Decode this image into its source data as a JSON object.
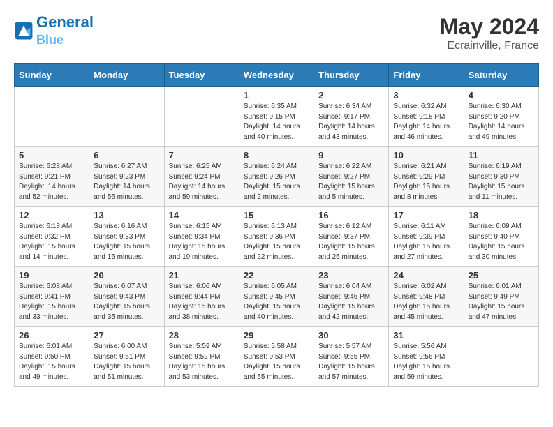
{
  "header": {
    "logo_line1": "General",
    "logo_line2": "Blue",
    "month_year": "May 2024",
    "location": "Ecrainville, France"
  },
  "weekdays": [
    "Sunday",
    "Monday",
    "Tuesday",
    "Wednesday",
    "Thursday",
    "Friday",
    "Saturday"
  ],
  "weeks": [
    [
      {
        "num": "",
        "info": ""
      },
      {
        "num": "",
        "info": ""
      },
      {
        "num": "",
        "info": ""
      },
      {
        "num": "1",
        "info": "Sunrise: 6:35 AM\nSunset: 9:15 PM\nDaylight: 14 hours\nand 40 minutes."
      },
      {
        "num": "2",
        "info": "Sunrise: 6:34 AM\nSunset: 9:17 PM\nDaylight: 14 hours\nand 43 minutes."
      },
      {
        "num": "3",
        "info": "Sunrise: 6:32 AM\nSunset: 9:18 PM\nDaylight: 14 hours\nand 46 minutes."
      },
      {
        "num": "4",
        "info": "Sunrise: 6:30 AM\nSunset: 9:20 PM\nDaylight: 14 hours\nand 49 minutes."
      }
    ],
    [
      {
        "num": "5",
        "info": "Sunrise: 6:28 AM\nSunset: 9:21 PM\nDaylight: 14 hours\nand 52 minutes."
      },
      {
        "num": "6",
        "info": "Sunrise: 6:27 AM\nSunset: 9:23 PM\nDaylight: 14 hours\nand 56 minutes."
      },
      {
        "num": "7",
        "info": "Sunrise: 6:25 AM\nSunset: 9:24 PM\nDaylight: 14 hours\nand 59 minutes."
      },
      {
        "num": "8",
        "info": "Sunrise: 6:24 AM\nSunset: 9:26 PM\nDaylight: 15 hours\nand 2 minutes."
      },
      {
        "num": "9",
        "info": "Sunrise: 6:22 AM\nSunset: 9:27 PM\nDaylight: 15 hours\nand 5 minutes."
      },
      {
        "num": "10",
        "info": "Sunrise: 6:21 AM\nSunset: 9:29 PM\nDaylight: 15 hours\nand 8 minutes."
      },
      {
        "num": "11",
        "info": "Sunrise: 6:19 AM\nSunset: 9:30 PM\nDaylight: 15 hours\nand 11 minutes."
      }
    ],
    [
      {
        "num": "12",
        "info": "Sunrise: 6:18 AM\nSunset: 9:32 PM\nDaylight: 15 hours\nand 14 minutes."
      },
      {
        "num": "13",
        "info": "Sunrise: 6:16 AM\nSunset: 9:33 PM\nDaylight: 15 hours\nand 16 minutes."
      },
      {
        "num": "14",
        "info": "Sunrise: 6:15 AM\nSunset: 9:34 PM\nDaylight: 15 hours\nand 19 minutes."
      },
      {
        "num": "15",
        "info": "Sunrise: 6:13 AM\nSunset: 9:36 PM\nDaylight: 15 hours\nand 22 minutes."
      },
      {
        "num": "16",
        "info": "Sunrise: 6:12 AM\nSunset: 9:37 PM\nDaylight: 15 hours\nand 25 minutes."
      },
      {
        "num": "17",
        "info": "Sunrise: 6:11 AM\nSunset: 9:39 PM\nDaylight: 15 hours\nand 27 minutes."
      },
      {
        "num": "18",
        "info": "Sunrise: 6:09 AM\nSunset: 9:40 PM\nDaylight: 15 hours\nand 30 minutes."
      }
    ],
    [
      {
        "num": "19",
        "info": "Sunrise: 6:08 AM\nSunset: 9:41 PM\nDaylight: 15 hours\nand 33 minutes."
      },
      {
        "num": "20",
        "info": "Sunrise: 6:07 AM\nSunset: 9:43 PM\nDaylight: 15 hours\nand 35 minutes."
      },
      {
        "num": "21",
        "info": "Sunrise: 6:06 AM\nSunset: 9:44 PM\nDaylight: 15 hours\nand 38 minutes."
      },
      {
        "num": "22",
        "info": "Sunrise: 6:05 AM\nSunset: 9:45 PM\nDaylight: 15 hours\nand 40 minutes."
      },
      {
        "num": "23",
        "info": "Sunrise: 6:04 AM\nSunset: 9:46 PM\nDaylight: 15 hours\nand 42 minutes."
      },
      {
        "num": "24",
        "info": "Sunrise: 6:02 AM\nSunset: 9:48 PM\nDaylight: 15 hours\nand 45 minutes."
      },
      {
        "num": "25",
        "info": "Sunrise: 6:01 AM\nSunset: 9:49 PM\nDaylight: 15 hours\nand 47 minutes."
      }
    ],
    [
      {
        "num": "26",
        "info": "Sunrise: 6:01 AM\nSunset: 9:50 PM\nDaylight: 15 hours\nand 49 minutes."
      },
      {
        "num": "27",
        "info": "Sunrise: 6:00 AM\nSunset: 9:51 PM\nDaylight: 15 hours\nand 51 minutes."
      },
      {
        "num": "28",
        "info": "Sunrise: 5:59 AM\nSunset: 9:52 PM\nDaylight: 15 hours\nand 53 minutes."
      },
      {
        "num": "29",
        "info": "Sunrise: 5:58 AM\nSunset: 9:53 PM\nDaylight: 15 hours\nand 55 minutes."
      },
      {
        "num": "30",
        "info": "Sunrise: 5:57 AM\nSunset: 9:55 PM\nDaylight: 15 hours\nand 57 minutes."
      },
      {
        "num": "31",
        "info": "Sunrise: 5:56 AM\nSunset: 9:56 PM\nDaylight: 15 hours\nand 59 minutes."
      },
      {
        "num": "",
        "info": ""
      }
    ]
  ]
}
